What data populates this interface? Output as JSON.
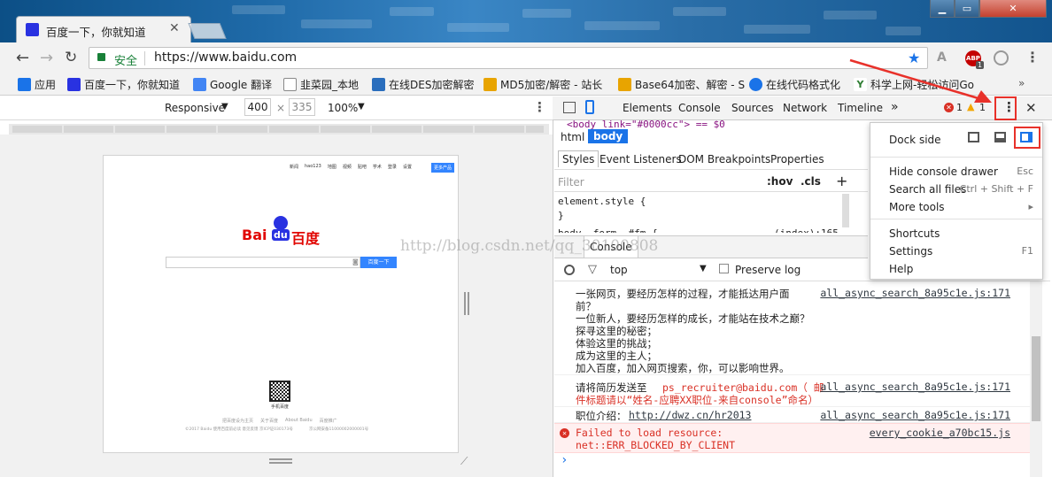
{
  "browser": {
    "tab_title": "百度一下，你就知道",
    "security_label": "安全",
    "url": "https://www.baidu.com",
    "abp_badge": "1"
  },
  "bookmarks": [
    {
      "label": "应用",
      "icon": "apps-grid-icon",
      "color": "#1a73e8"
    },
    {
      "label": "百度一下，你就知道",
      "icon": "baidu-paw-icon",
      "color": "#2932e1"
    },
    {
      "label": "Google 翻译",
      "icon": "google-translate-icon",
      "color": "#4285f4"
    },
    {
      "label": "韭菜园_本地",
      "icon": "page-icon",
      "color": "#888888"
    },
    {
      "label": "在线DES加密解密",
      "icon": "puzzle-icon",
      "color": "#2a6ebd"
    },
    {
      "label": "MD5加密/解密 - 站长",
      "icon": "tool-icon",
      "color": "#e8a400"
    },
    {
      "label": "Base64加密、解密 - S",
      "icon": "tool-icon",
      "color": "#e8a400"
    },
    {
      "label": "在线代码格式化",
      "icon": "refresh-c-icon",
      "color": "#1a73e8"
    },
    {
      "label": "科学上网-轻松访问Go",
      "icon": "y-icon",
      "color": "#2e7d32"
    }
  ],
  "device": {
    "mode": "Responsive",
    "width": "400",
    "times": "×",
    "height": "335",
    "zoom": "100%"
  },
  "baidu": {
    "nav": [
      "新闻",
      "hao123",
      "地图",
      "视频",
      "贴吧",
      "学术",
      "登录",
      "设置"
    ],
    "more_products": "更多产品",
    "logo_left": "Bai",
    "logo_mid": "du",
    "logo_right": "百度",
    "search_button": "百度一下",
    "qr_caption": "手机百度",
    "footer_links": [
      "把百度设为主页",
      "关于百度",
      "About Baidu",
      "百度推广"
    ],
    "copyright": "©2017 Baidu 使用百度前必读 意见反馈 京ICP证030173号",
    "police": "京公网安备11000002000001号"
  },
  "devtools": {
    "tabs": [
      "Elements",
      "Console",
      "Sources",
      "Network",
      "Timeline"
    ],
    "more_tabs": "»",
    "errors": "1",
    "warnings": "1",
    "dom_line": "<body link=\"#0000cc\"> == $0",
    "crumbs": [
      "html",
      "body"
    ],
    "style_tabs": [
      "Styles",
      "Event Listeners",
      "DOM Breakpoints",
      "Properties"
    ],
    "filter_placeholder": "Filter",
    "hov": ":hov",
    "cls": ".cls",
    "plus": "+",
    "element_style": "element.style {",
    "close_brace": "}",
    "partial_rule": "body, form, #fm {",
    "partial_source": "(index):165",
    "drawer_tab": "Console",
    "context": "top",
    "preserve_log": "Preserve log",
    "messages": [
      {
        "text_lines": [
          "一张网页，要经历怎样的过程，才能抵达用户面",
          "前？",
          "一位新人，要经历怎样的成长，才能站在技术之巅？",
          "探寻这里的秘密；",
          "体验这里的挑战；",
          "成为这里的主人；",
          "加入百度，加入网页搜索，你，可以影响世界。"
        ],
        "source": "all_async_search_8a95c1e.js:171"
      },
      {
        "prefix": "请将简历发送至 ",
        "email": "ps_recruiter@baidu.com（ 邮",
        "line2": "件标题请以“姓名-应聘XX职位-来自console”命名）",
        "source": "all_async_search_8a95c1e.js:171"
      },
      {
        "prefix": "职位介绍：",
        "link": "http://dwz.cn/hr2013",
        "source": "all_async_search_8a95c1e.js:171"
      },
      {
        "error_line1": "Failed to load resource:",
        "error_line2": "net::ERR_BLOCKED_BY_CLIENT",
        "source": "every_cookie_a70bc15.js"
      }
    ],
    "prompt": "›",
    "menu": {
      "dock_side": "Dock side",
      "items": [
        {
          "label": "Hide console drawer",
          "shortcut": "Esc"
        },
        {
          "label": "Search all files",
          "shortcut": "Ctrl + Shift + F"
        },
        {
          "label": "More tools",
          "shortcut": "▸"
        },
        {
          "label": "Shortcuts",
          "shortcut": ""
        },
        {
          "label": "Settings",
          "shortcut": "F1"
        },
        {
          "label": "Help",
          "shortcut": ""
        }
      ]
    }
  },
  "watermark": "http://blog.csdn.net/qq_30100808",
  "colors": {
    "accent_red": "#e8312a",
    "devtools_blue": "#1a73e8",
    "error_red": "#d93025",
    "error_bg": "#fff0f0",
    "baidu_blue": "#3385ff"
  }
}
